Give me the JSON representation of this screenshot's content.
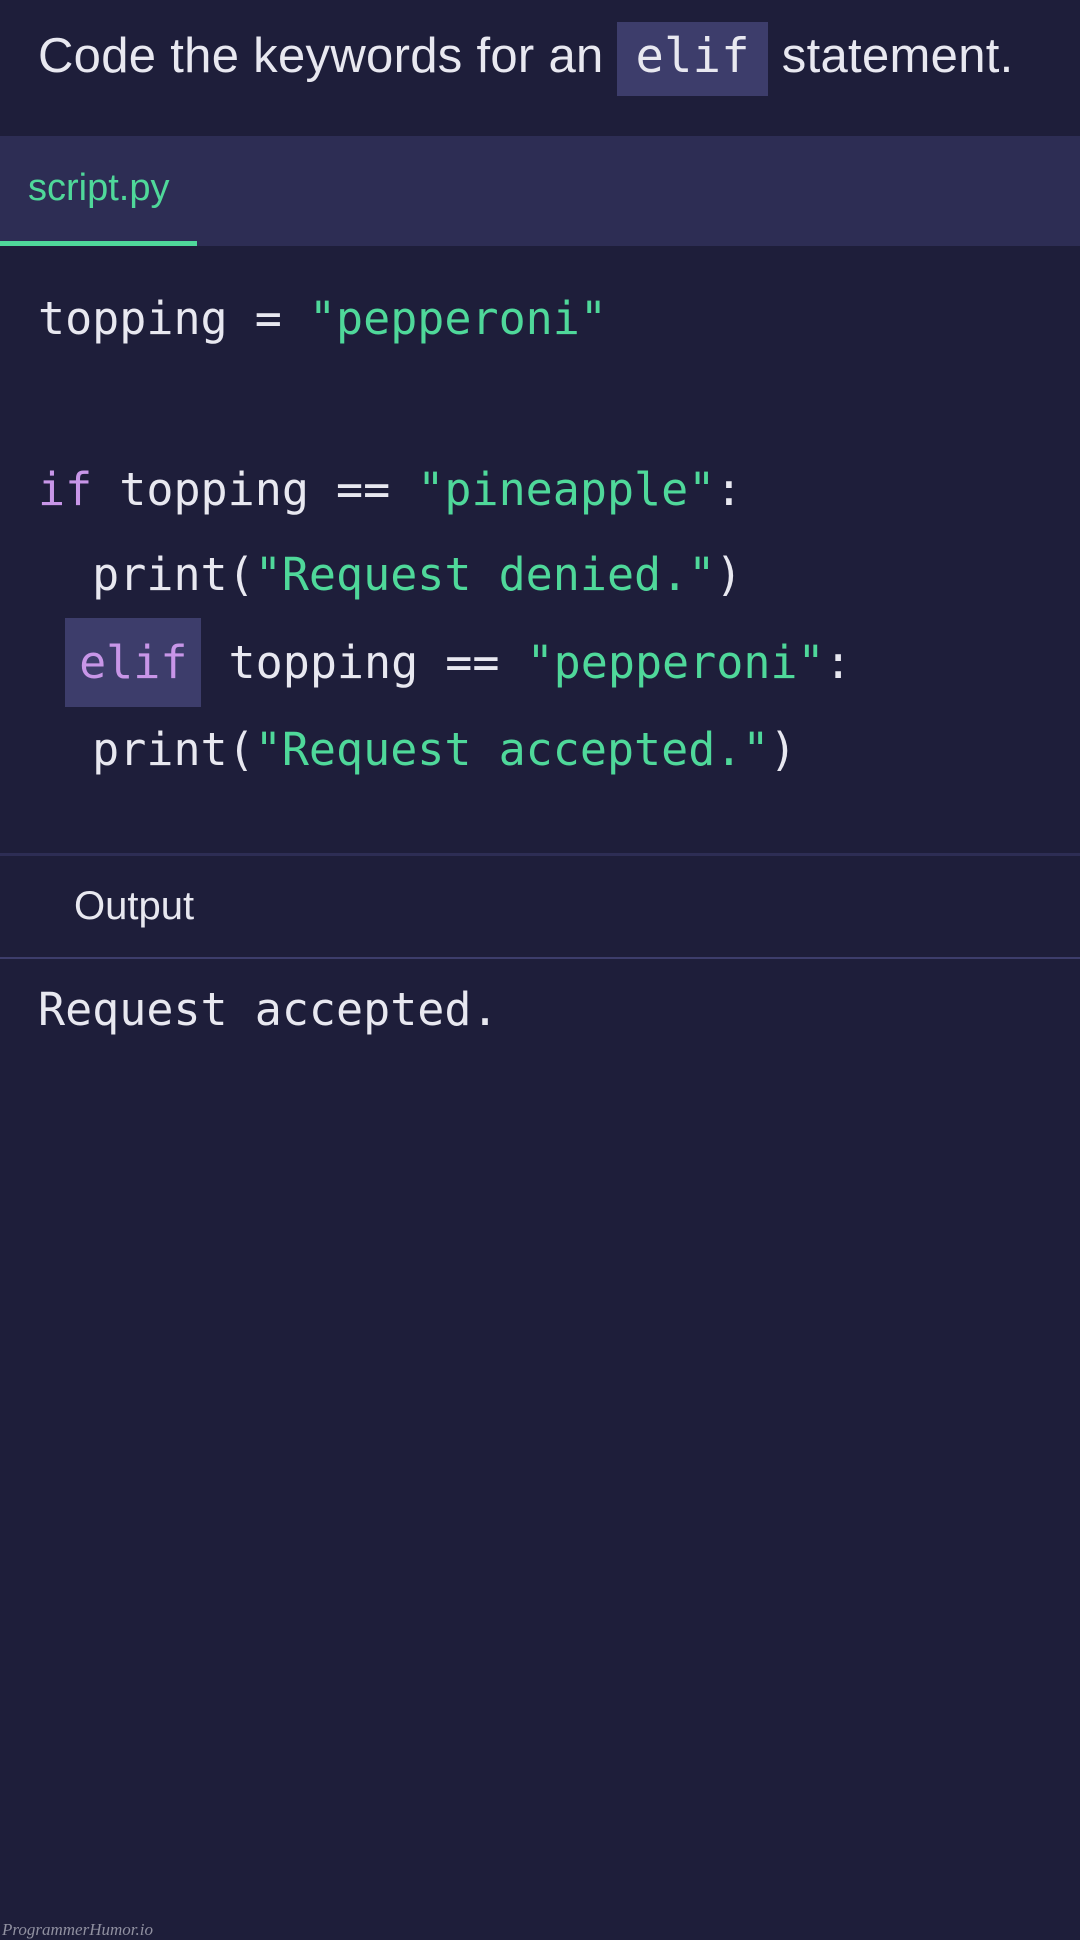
{
  "prompt": {
    "prefix": "Code the keywords for an ",
    "code": "elif",
    "suffix": " statement."
  },
  "tab": {
    "label": "script.py"
  },
  "code": {
    "line1_var": "topping",
    "line1_op": " = ",
    "line1_str": "\"pepperoni\"",
    "line3_kw": "if",
    "line3_mid": " topping == ",
    "line3_str": "\"pineapple\"",
    "line3_colon": ":",
    "line4_prefix": "  print(",
    "line4_str": "\"Request denied.\"",
    "line4_suffix": ")",
    "line5_blank": "elif",
    "line5_mid": " topping == ",
    "line5_str": "\"pepperoni\"",
    "line5_colon": ":",
    "line6_prefix": "  print(",
    "line6_str": "\"Request accepted.\"",
    "line6_suffix": ")"
  },
  "output": {
    "label": "Output",
    "text": "Request accepted."
  },
  "watermark": "ProgrammerHumor.io"
}
